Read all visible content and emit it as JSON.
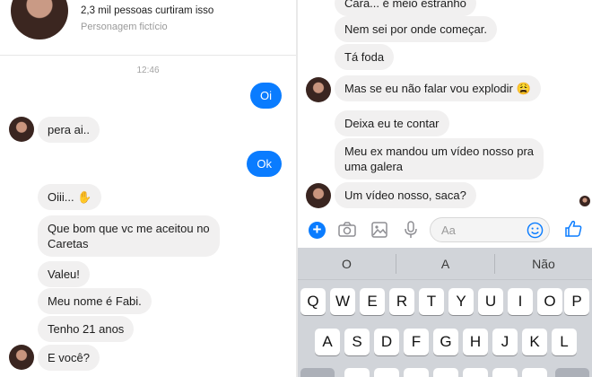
{
  "left": {
    "profile": {
      "likes": "2,3 mil pessoas curtiram isso",
      "type": "Personagem fictício"
    },
    "timestamp": "12:46",
    "messages": [
      {
        "dir": "out",
        "text": "Oi"
      },
      {
        "dir": "in",
        "text": "pera ai.."
      },
      {
        "dir": "out",
        "text": "Ok"
      },
      {
        "dir": "in",
        "text": "Oiii... ✋"
      },
      {
        "dir": "in",
        "text": "Que bom que vc me aceitou no",
        "text2": "Caretas"
      },
      {
        "dir": "in",
        "text": "Valeu!"
      },
      {
        "dir": "in",
        "text": "Meu nome é Fabi."
      },
      {
        "dir": "in",
        "text": "Tenho 21 anos"
      },
      {
        "dir": "in",
        "text": "E você?"
      }
    ]
  },
  "right": {
    "messages": [
      {
        "dir": "in",
        "text": "Cara... é meio estranho"
      },
      {
        "dir": "in",
        "text": "Nem sei por onde começar."
      },
      {
        "dir": "in",
        "text": "Tá foda"
      },
      {
        "dir": "in",
        "text": "Mas se eu não falar vou explodir 😩"
      },
      {
        "dir": "in",
        "text": "Deixa eu te contar"
      },
      {
        "dir": "in",
        "text": "Meu ex mandou um vídeo nosso pra",
        "text2": "uma galera"
      },
      {
        "dir": "in",
        "text": "Um vídeo nosso, saca?"
      }
    ],
    "composer": {
      "placeholder": "Aa",
      "icons": [
        "plus-icon",
        "camera-icon",
        "image-icon",
        "microphone-icon",
        "emoji-icon",
        "thumbs-up-icon"
      ],
      "accent": "#0a7cff"
    },
    "keyboard": {
      "suggestions": [
        "O",
        "A",
        "Não"
      ],
      "row1": [
        "Q",
        "W",
        "E",
        "R",
        "T",
        "Y",
        "U",
        "I",
        "O",
        "P"
      ],
      "row2": [
        "A",
        "S",
        "D",
        "F",
        "G",
        "H",
        "J",
        "K",
        "L"
      ]
    }
  }
}
